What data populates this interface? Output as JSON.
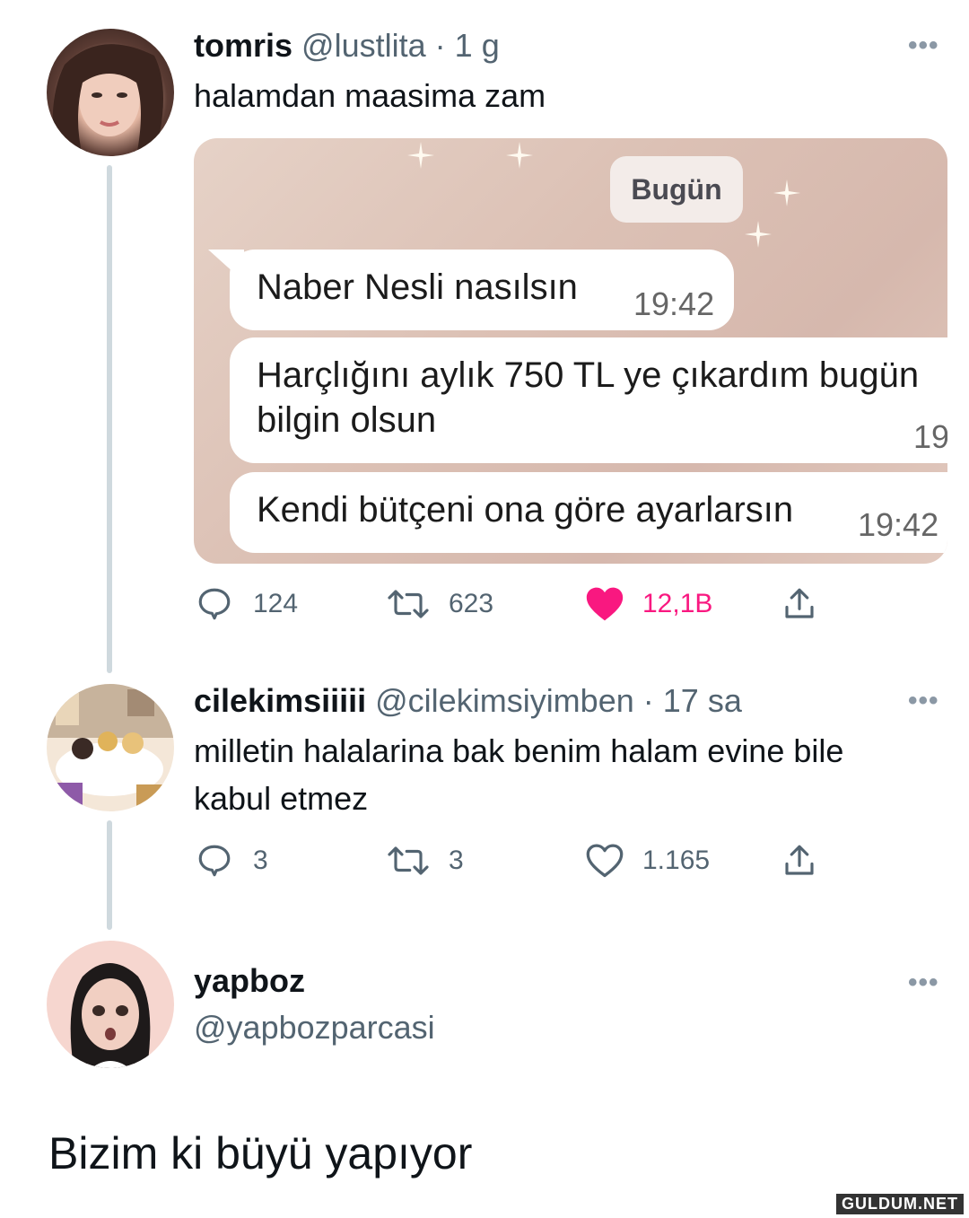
{
  "tweet1": {
    "name": "tomris",
    "handle": "@lustlita",
    "separator": "·",
    "time": "1 g",
    "text": "halamdan maasima zam",
    "more": "•••",
    "media": {
      "date_chip": "Bugün",
      "messages": [
        {
          "text": "Naber Nesli nasılsın",
          "time": "19:42"
        },
        {
          "text_line1": "Harçlığını aylık 750 TL ye çıkardım bugün",
          "text_line2": "bilgin olsun",
          "time": "19"
        },
        {
          "text": "Kendi bütçeni ona göre ayarlarsın",
          "time": "19:42"
        }
      ]
    },
    "actions": {
      "replies": "124",
      "retweets": "623",
      "likes": "12,1B",
      "liked": true
    }
  },
  "tweet2": {
    "name": "cilekimsiiiii",
    "handle": "@cilekimsiyimben",
    "separator": "·",
    "time": "17 sa",
    "text_line1": "milletin halalarina bak benim halam evine bile",
    "text_line2": "kabul etmez",
    "more": "•••",
    "actions": {
      "replies": "3",
      "retweets": "3",
      "likes": "1.165",
      "liked": false
    }
  },
  "tweet3": {
    "name": "yapboz",
    "handle": "@yapbozparcasi",
    "more": "•••",
    "text": "Bizim ki büyü yapıyor"
  },
  "watermark": "GULDUM.NET",
  "colors": {
    "like_active": "#f91880",
    "secondary_text": "#536471",
    "thread_line": "#cfd9de"
  }
}
